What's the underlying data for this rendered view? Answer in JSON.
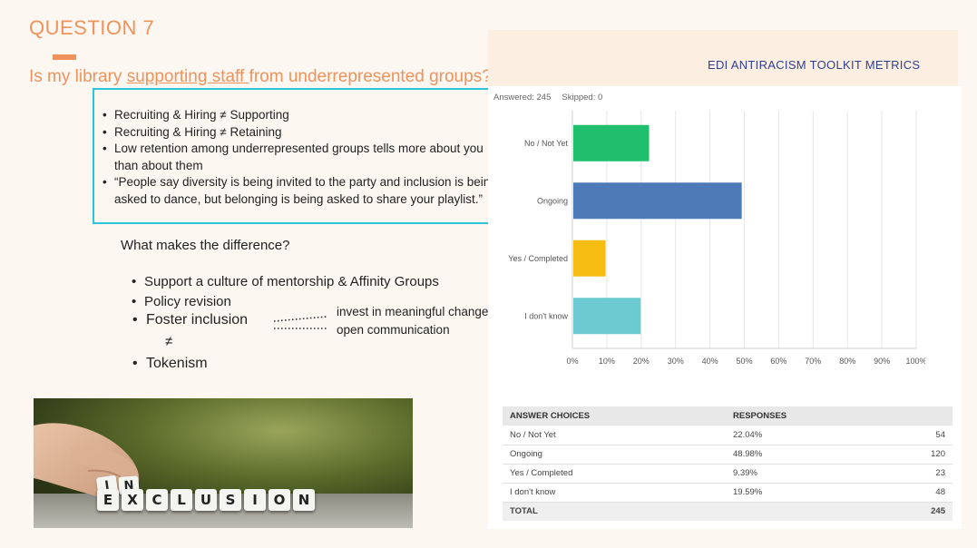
{
  "slide": {
    "question_number": "QUESTION 7",
    "question_prefix": "Is my library ",
    "question_underlined": "supporting staff ",
    "question_suffix": "from underrepresented groups?",
    "bullets": [
      "Recruiting & Hiring ≠ Supporting",
      "Recruiting & Hiring ≠ Retaining",
      "Low retention among underrepresented groups tells more about you than about them",
      "“People say diversity is being invited to the party and inclusion is being asked to dance, but belonging is being asked to share your playlist.”"
    ],
    "difference_heading": "What makes the difference?",
    "difference_items": [
      "Support a culture of mentorship & Affinity Groups",
      "Policy revision"
    ],
    "foster": "Foster inclusion",
    "neq": "≠",
    "tokenism": "Tokenism",
    "foster_notes": [
      "invest in meaningful change",
      "open communication"
    ],
    "dice_top": [
      "I",
      "N"
    ],
    "dice_bottom": [
      "E",
      "X",
      "C",
      "L",
      "U",
      "S",
      "I",
      "O",
      "N"
    ]
  },
  "survey": {
    "title": "EDI ANTIRACISM TOOLKIT METRICS",
    "answered": "Answered: 245",
    "skipped": "Skipped: 0"
  },
  "chart_data": {
    "type": "bar",
    "orientation": "horizontal",
    "categories": [
      "No / Not Yet",
      "Ongoing",
      "Yes / Completed",
      "I don't know"
    ],
    "values": [
      22.04,
      48.98,
      9.39,
      19.59
    ],
    "colors": [
      "#1fbf6e",
      "#4e7ab8",
      "#f5bc12",
      "#6ccbd0"
    ],
    "xlim": [
      0,
      100
    ],
    "x_ticks": [
      "0%",
      "10%",
      "20%",
      "30%",
      "40%",
      "50%",
      "60%",
      "70%",
      "80%",
      "90%",
      "100%"
    ],
    "grid": true
  },
  "table": {
    "headers": [
      "ANSWER CHOICES",
      "RESPONSES",
      ""
    ],
    "rows": [
      [
        "No / Not Yet",
        "22.04%",
        "54"
      ],
      [
        "Ongoing",
        "48.98%",
        "120"
      ],
      [
        "Yes / Completed",
        "9.39%",
        "23"
      ],
      [
        "I don't know",
        "19.59%",
        "48"
      ]
    ],
    "total_label": "TOTAL",
    "total_value": "245"
  }
}
